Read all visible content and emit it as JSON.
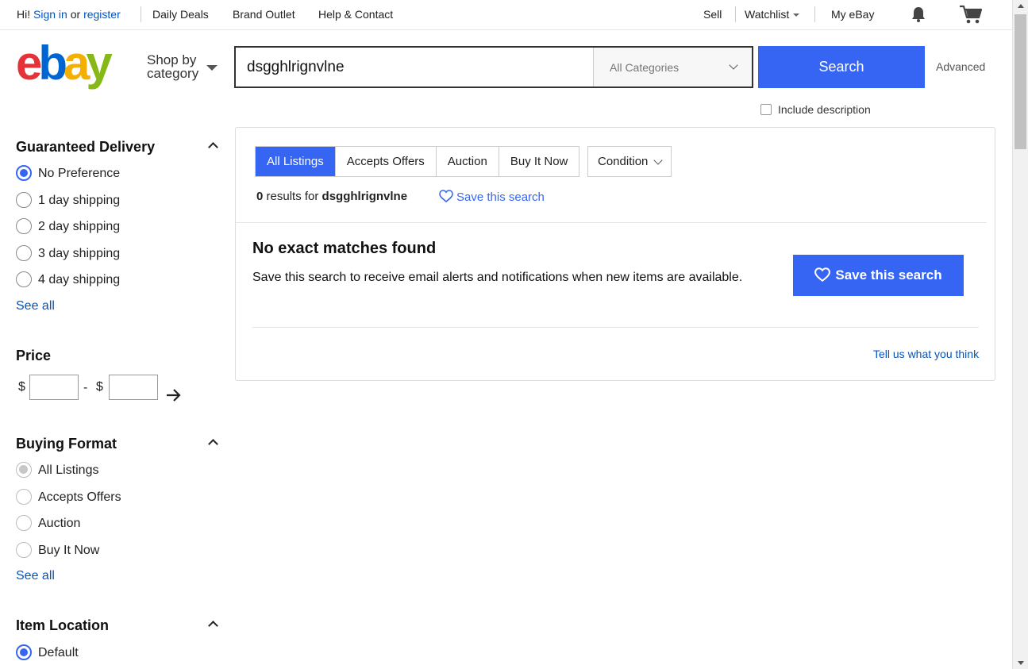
{
  "topnav": {
    "greeting": "Hi!",
    "sign_in": "Sign in",
    "or": "or",
    "register": "register",
    "daily_deals": "Daily Deals",
    "brand_outlet": "Brand Outlet",
    "help_contact": "Help & Contact",
    "sell": "Sell",
    "watchlist": "Watchlist",
    "my_ebay": "My eBay",
    "icons": [
      "bell-icon",
      "cart-icon"
    ]
  },
  "header": {
    "logo_text": "ebay",
    "shop_by_line1": "Shop by",
    "shop_by_line2": "category",
    "search_value": "dsgghlrignvlne",
    "category_selected": "All Categories",
    "search_button": "Search",
    "advanced": "Advanced",
    "include_description": "Include description"
  },
  "sidebar": {
    "guaranteed_delivery": {
      "title": "Guaranteed Delivery",
      "options": [
        "No Preference",
        "1 day shipping",
        "2 day shipping",
        "3 day shipping",
        "4 day shipping"
      ],
      "selected": "No Preference",
      "see_all": "See all"
    },
    "price": {
      "title": "Price",
      "currency": "$",
      "separator": "-"
    },
    "buying_format": {
      "title": "Buying Format",
      "options": [
        "All Listings",
        "Accepts Offers",
        "Auction",
        "Buy It Now"
      ],
      "selected": "All Listings",
      "see_all": "See all"
    },
    "item_location": {
      "title": "Item Location",
      "options": [
        "Default"
      ],
      "selected": "Default"
    }
  },
  "results": {
    "tabs": [
      "All Listings",
      "Accepts Offers",
      "Auction",
      "Buy It Now"
    ],
    "active_tab": "All Listings",
    "condition": "Condition",
    "count": "0",
    "results_for": "results for",
    "query": "dsgghlrignvlne",
    "save_search_link": "Save this search",
    "no_match_title": "No exact matches found",
    "no_match_body": "Save this search to receive email alerts and notifications when new items are available.",
    "save_search_button": "Save this search",
    "tell_us": "Tell us what you think"
  },
  "colors": {
    "accent": "#3665f3",
    "link": "#0654ba",
    "logo_e": "#e53238",
    "logo_b": "#0064d2",
    "logo_a": "#f5af02",
    "logo_y": "#86b817"
  }
}
